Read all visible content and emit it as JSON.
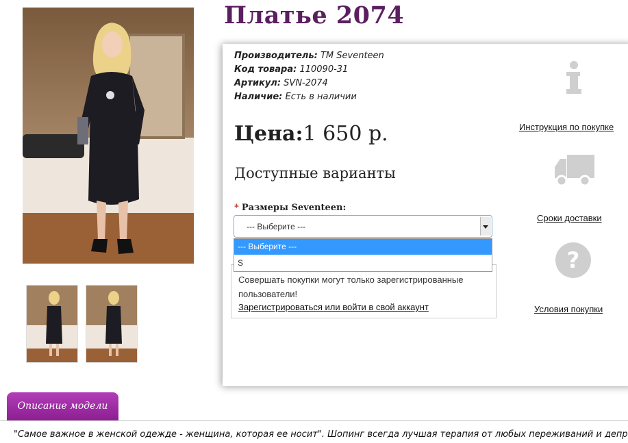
{
  "product": {
    "title": "Платье 2074",
    "manufacturer_label": "Производитель:",
    "manufacturer_value": "TM Seventeen",
    "code_label": "Код товара:",
    "code_value": "110090-31",
    "sku_label": "Артикул:",
    "sku_value": "SVN-2074",
    "availability_label": "Наличие:",
    "availability_value": "Есть в наличии",
    "price_label": "Цена:",
    "price_value": "1 650 р.",
    "variants_heading": "Доступные варианты"
  },
  "options": {
    "required_mark": "*",
    "size_label": "Размеры Seventeen:",
    "selected_value": "--- Выберите ---",
    "items": [
      "--- Выберите ---",
      "S"
    ]
  },
  "notice": {
    "message": "Совершать покупки могут только зарегистрированные пользователи!",
    "register_link": "Зарегистрироваться или войти в свой аккаунт"
  },
  "sidebar": {
    "instruction": "Инструкция по покупке",
    "delivery": "Сроки доставки",
    "terms": "Условия покупки"
  },
  "tabs": {
    "description": "Описание модели"
  },
  "description": {
    "text": "\"Самое важное в женской одежде - женщина, которая ее носит\". Шопинг всегда лучшая терапия от любых переживаний и депрессий."
  },
  "colors": {
    "title": "#5b1f60",
    "tab": "#9c2aa1",
    "selected_option": "#3399ff"
  },
  "icons": {
    "instruction": "info-icon",
    "delivery": "truck-icon",
    "terms": "question-icon"
  }
}
